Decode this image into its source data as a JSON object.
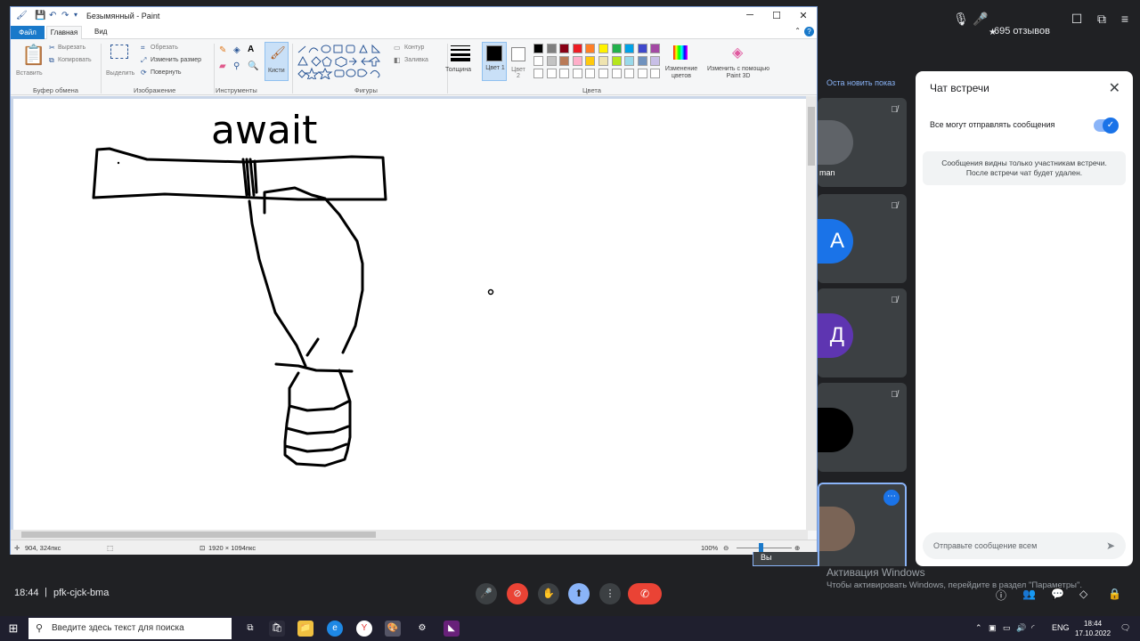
{
  "meet": {
    "reviews": "695 отзывов",
    "clock": "18:44",
    "code_sep": "|",
    "meet_code": "pfk-cjck-bma",
    "activation_title": "Активация Windows",
    "activation_sub": "Чтобы активировать Windows, перейдите в раздел \"Параметры\".",
    "left_notice": "Оста новить показ",
    "tiles": [
      {
        "name": "man",
        "letter": "",
        "color": "#3c4043"
      },
      {
        "name": "",
        "letter": "A",
        "color": "#1a73e8"
      },
      {
        "name": "",
        "letter": "Д",
        "color": "#5e35b1"
      },
      {
        "name": "",
        "letter": "",
        "color": "#000000"
      }
    ],
    "you_label": "Вы"
  },
  "chat": {
    "title": "Чат встречи",
    "allow_label": "Все могут отправлять сообщения",
    "allow_enabled": true,
    "info_line1": "Сообщения видны только участникам встречи.",
    "info_line2": "После встречи чат будет удален.",
    "input_placeholder": "Отправьте сообщение всем"
  },
  "paint": {
    "title": "Безымянный - Paint",
    "menu": {
      "file": "Файл",
      "home": "Главная",
      "view": "Вид"
    },
    "clipboard": {
      "paste": "Вставить",
      "cut": "Вырезать",
      "copy": "Копировать",
      "label": "Буфер обмена"
    },
    "image": {
      "select": "Выделить",
      "crop": "Обрезать",
      "resize": "Изменить размер",
      "rotate": "Повернуть",
      "label": "Изображение"
    },
    "tools": {
      "brushes": "Кисти",
      "label": "Инструменты"
    },
    "shapes": {
      "outline": "Контур",
      "fill": "Заливка",
      "label": "Фигуры"
    },
    "size_label": "Толщина",
    "color1_label": "Цвет 1",
    "color2_label": "Цвет 2",
    "colors_label": "Цвета",
    "edit_colors": "Изменение цветов",
    "paint3d": "Изменить с помощью Paint 3D",
    "palette_row1": [
      "#000000",
      "#7f7f7f",
      "#880015",
      "#ed1c24",
      "#ff7f27",
      "#fff200",
      "#22b14c",
      "#00a2e8",
      "#3f48cc",
      "#a349a4"
    ],
    "palette_row2": [
      "#ffffff",
      "#c3c3c3",
      "#b97a57",
      "#ffaec9",
      "#ffc90e",
      "#efe4b0",
      "#b5e61d",
      "#99d9ea",
      "#7092be",
      "#c8bfe7"
    ],
    "canvas_text": "await",
    "status": {
      "cursor": "904, 324пкс",
      "size": "1920 × 1094пкс",
      "zoom": "100%"
    }
  },
  "taskbar": {
    "search_placeholder": "Введите здесь текст для поиска",
    "lang": "ENG",
    "time": "18:44",
    "date": "17.10.2022"
  }
}
